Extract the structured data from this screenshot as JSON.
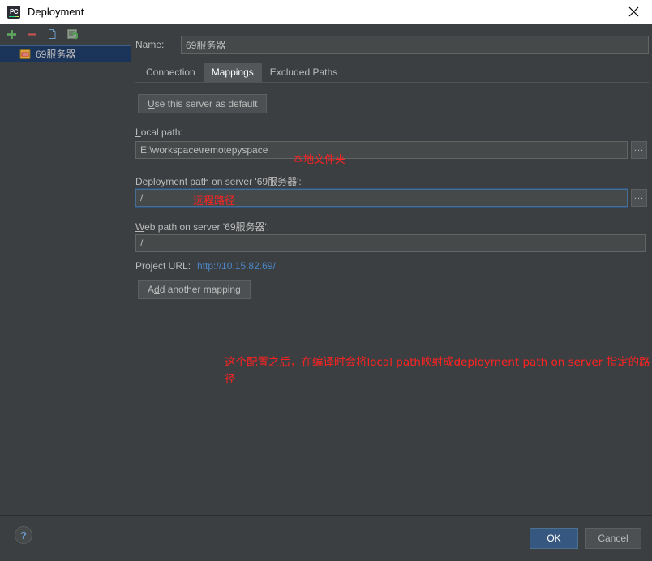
{
  "window": {
    "title": "Deployment",
    "app_icon": "pycharm-icon",
    "close_icon": "close-icon"
  },
  "sidebar": {
    "toolbar": [
      {
        "name": "add-server-button",
        "icon": "plus-icon",
        "label": "+"
      },
      {
        "name": "remove-server-button",
        "icon": "minus-icon",
        "label": "−"
      },
      {
        "name": "copy-server-button",
        "icon": "copy-icon",
        "label": ""
      },
      {
        "name": "sync-server-button",
        "icon": "sync-icon",
        "label": ""
      }
    ],
    "servers": [
      {
        "label": "69服务器",
        "selected": true,
        "icon": "server-icon"
      }
    ]
  },
  "form": {
    "name_label": "Name:",
    "name_label_prefix": "Na",
    "name_label_mnemonic": "m",
    "name_label_suffix": "e:",
    "name_value": "69服务器",
    "tabs": [
      {
        "label": "Connection",
        "active": false
      },
      {
        "label": "Mappings",
        "active": true
      },
      {
        "label": "Excluded Paths",
        "active": false
      }
    ],
    "use_default_button": {
      "prefix": "",
      "mnemonic": "U",
      "suffix": "se this server as default"
    },
    "local_path": {
      "label_prefix": "",
      "label_mnemonic": "L",
      "label_suffix": "ocal path:",
      "value": "E:\\workspace\\remotepyspace",
      "browse_label": "..."
    },
    "deployment_path": {
      "label_prefix": "D",
      "label_mnemonic": "e",
      "label_suffix": "ployment path on server '69服务器':",
      "value": "/",
      "browse_label": "..."
    },
    "web_path": {
      "label_prefix": "",
      "label_mnemonic": "W",
      "label_suffix": "eb path on server '69服务器':",
      "value": "/"
    },
    "project_url": {
      "label": "Project URL:",
      "url": "http://10.15.82.69/"
    },
    "add_mapping_button": {
      "prefix": "A",
      "mnemonic": "d",
      "suffix": "d another mapping"
    }
  },
  "annotations": {
    "local_folder": "本地文件夹",
    "remote_path": "远程路径",
    "explanation": "这个配置之后，在编译时会将local path映射成deployment path on server 指定的路径"
  },
  "footer": {
    "help_label": "?",
    "ok_label": "OK",
    "cancel_label": "Cancel"
  },
  "colors": {
    "background": "#3c3f41",
    "field_background": "#45494a",
    "accent_blue": "#365880",
    "link_blue": "#4a86c8",
    "annotation_red": "#ff2222",
    "selection_blue": "#1b3459"
  }
}
